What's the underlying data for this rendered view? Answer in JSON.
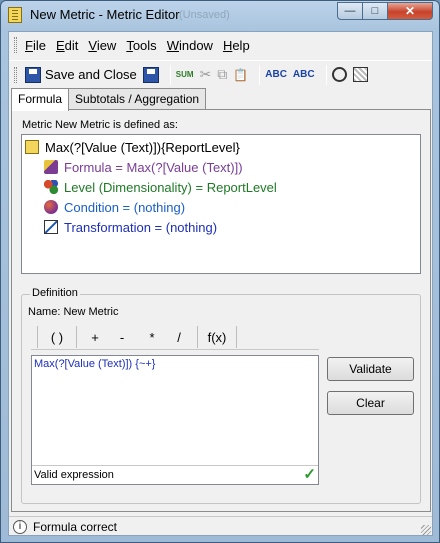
{
  "window": {
    "title": "New Metric - Metric Editor",
    "title_ghost": "(Unsaved)",
    "buttons": {
      "minimize": "—",
      "maximize": "□",
      "close": "✕"
    }
  },
  "menu": [
    {
      "mnemonic": "F",
      "rest": "ile"
    },
    {
      "mnemonic": "E",
      "rest": "dit"
    },
    {
      "mnemonic": "V",
      "rest": "iew"
    },
    {
      "mnemonic": "T",
      "rest": "ools"
    },
    {
      "mnemonic": "W",
      "rest": "indow"
    },
    {
      "mnemonic": "H",
      "rest": "elp"
    }
  ],
  "toolbar": {
    "save_close_label": "Save and Close",
    "sum_glyph": "SUM",
    "cut_glyph": "✂",
    "copy_glyph": "⧉",
    "paste_glyph": "📋",
    "abc_glyph": "ABC",
    "abc2_glyph": "ABC"
  },
  "tabs": {
    "formula": "Formula",
    "subtotals": "Subtotals / Aggregation"
  },
  "metric": {
    "caption": "Metric  New Metric  is defined as:",
    "root": "Max(?[Value (Text)]){ReportLevel}",
    "formula": "Formula = Max(?[Value (Text)])",
    "level": "Level (Dimensionality) = ReportLevel",
    "condition": "Condition = (nothing)",
    "transformation": "Transformation = (nothing)"
  },
  "definition": {
    "legend": "Definition",
    "name_line": "Name:  New Metric",
    "operators": [
      "(  )",
      "+",
      "-",
      "*",
      "/",
      "f(x)"
    ],
    "expression": "Max(?[Value (Text)])",
    "expression_tail": " {~+}",
    "status": "Valid expression",
    "validate_label": "Validate",
    "clear_label": "Clear"
  },
  "statusbar": {
    "info_glyph": "i",
    "text": "Formula correct"
  }
}
